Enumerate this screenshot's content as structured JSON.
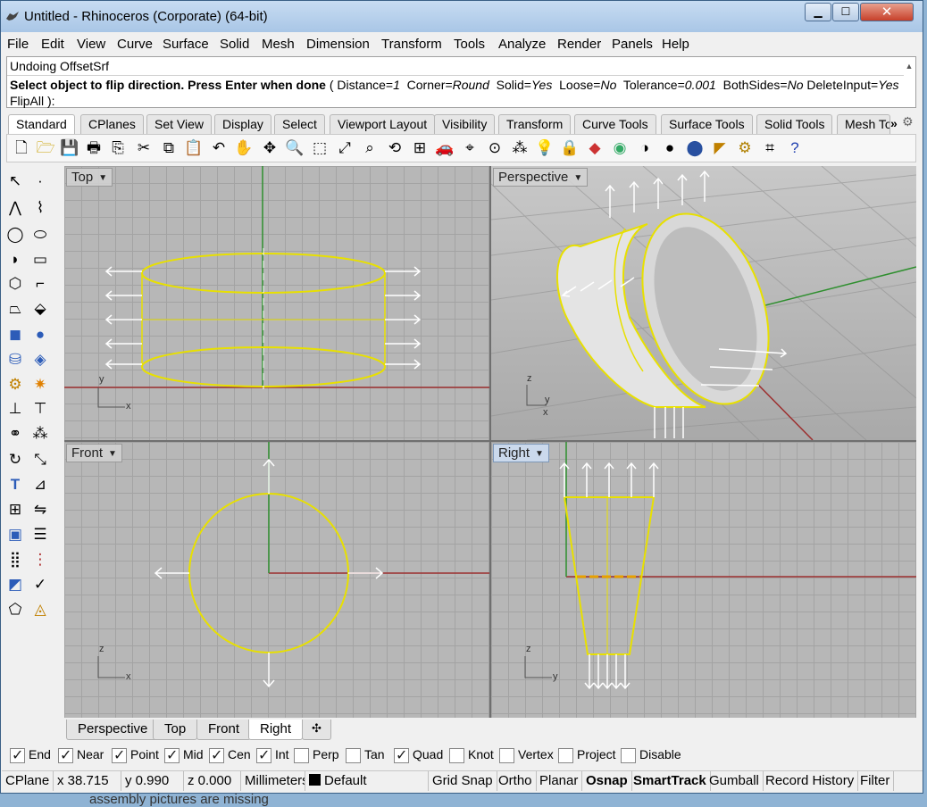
{
  "window": {
    "title": "Untitled - Rhinoceros (Corporate) (64-bit)",
    "min_glyph": "▁",
    "max_glyph": "☐",
    "close_glyph": "✕"
  },
  "menu": [
    "File",
    "Edit",
    "View",
    "Curve",
    "Surface",
    "Solid",
    "Mesh",
    "Dimension",
    "Transform",
    "Tools",
    "Analyze",
    "Render",
    "Panels",
    "Help"
  ],
  "command": {
    "history": "Undoing OffsetSrf",
    "prompt_bold": "Select object to flip direction. Press Enter when done",
    "opt_open": " ( ",
    "opt_distance_key": "Distance=",
    "opt_distance_val": "1",
    "opt_corner_key": "Corner=",
    "opt_corner_val": "Round",
    "opt_solid_key": "Solid=",
    "opt_solid_val": "Yes",
    "opt_loose_key": "Loose=",
    "opt_loose_val": "No",
    "opt_tolerance_key": "Tolerance=",
    "opt_tolerance_val": "0.001",
    "opt_bothsides_key": "BothSides=",
    "opt_bothsides_val": "No",
    "opt_deleteinput_key": "DeleteInput=",
    "opt_deleteinput_val": "Yes",
    "opt_flipall": "FlipAll",
    "opt_close": " ):"
  },
  "toolbar_tabs": [
    "Standard",
    "CPlanes",
    "Set View",
    "Display",
    "Select",
    "Viewport Layout",
    "Visibility",
    "Transform",
    "Curve Tools",
    "Surface Tools",
    "Solid Tools",
    "Mesh To"
  ],
  "toolbar_overflow": "»",
  "toolbar_gear": "⚙",
  "viewports": {
    "top": "Top",
    "perspective": "Perspective",
    "front": "Front",
    "right": "Right"
  },
  "axis_labels": {
    "top_x": "x",
    "top_y": "y",
    "persp_x": "x",
    "persp_y": "y",
    "persp_z": "z",
    "front_x": "x",
    "front_z": "z",
    "right_y": "y",
    "right_z": "z"
  },
  "viewport_tabs": [
    "Perspective",
    "Top",
    "Front",
    "Right"
  ],
  "viewport_tab_add": "✣",
  "osnap": [
    {
      "label": "End",
      "checked": true
    },
    {
      "label": "Near",
      "checked": true
    },
    {
      "label": "Point",
      "checked": true
    },
    {
      "label": "Mid",
      "checked": true
    },
    {
      "label": "Cen",
      "checked": true
    },
    {
      "label": "Int",
      "checked": true
    },
    {
      "label": "Perp",
      "checked": false
    },
    {
      "label": "Tan",
      "checked": false
    },
    {
      "label": "Quad",
      "checked": true
    },
    {
      "label": "Knot",
      "checked": false
    },
    {
      "label": "Vertex",
      "checked": false
    },
    {
      "label": "Project",
      "checked": false
    },
    {
      "label": "Disable",
      "checked": false
    }
  ],
  "status": {
    "cplane": "CPlane",
    "x": "x 38.715",
    "y": "y 0.990",
    "z": "z 0.000",
    "units": "Millimeters",
    "layer": "Default",
    "grid_snap": "Grid Snap",
    "ortho": "Ortho",
    "planar": "Planar",
    "osnap": "Osnap",
    "smarttrack": "SmartTrack",
    "gumball": "Gumball",
    "record_history": "Record History",
    "filter": "Filter"
  },
  "beneath_text": "assembly pictures are missing",
  "colors": {
    "selection": "#e8e000",
    "x_axis": "#9c2f2f",
    "y_axis": "#2f8f2f",
    "grid_bg": "#b7b7b7"
  }
}
